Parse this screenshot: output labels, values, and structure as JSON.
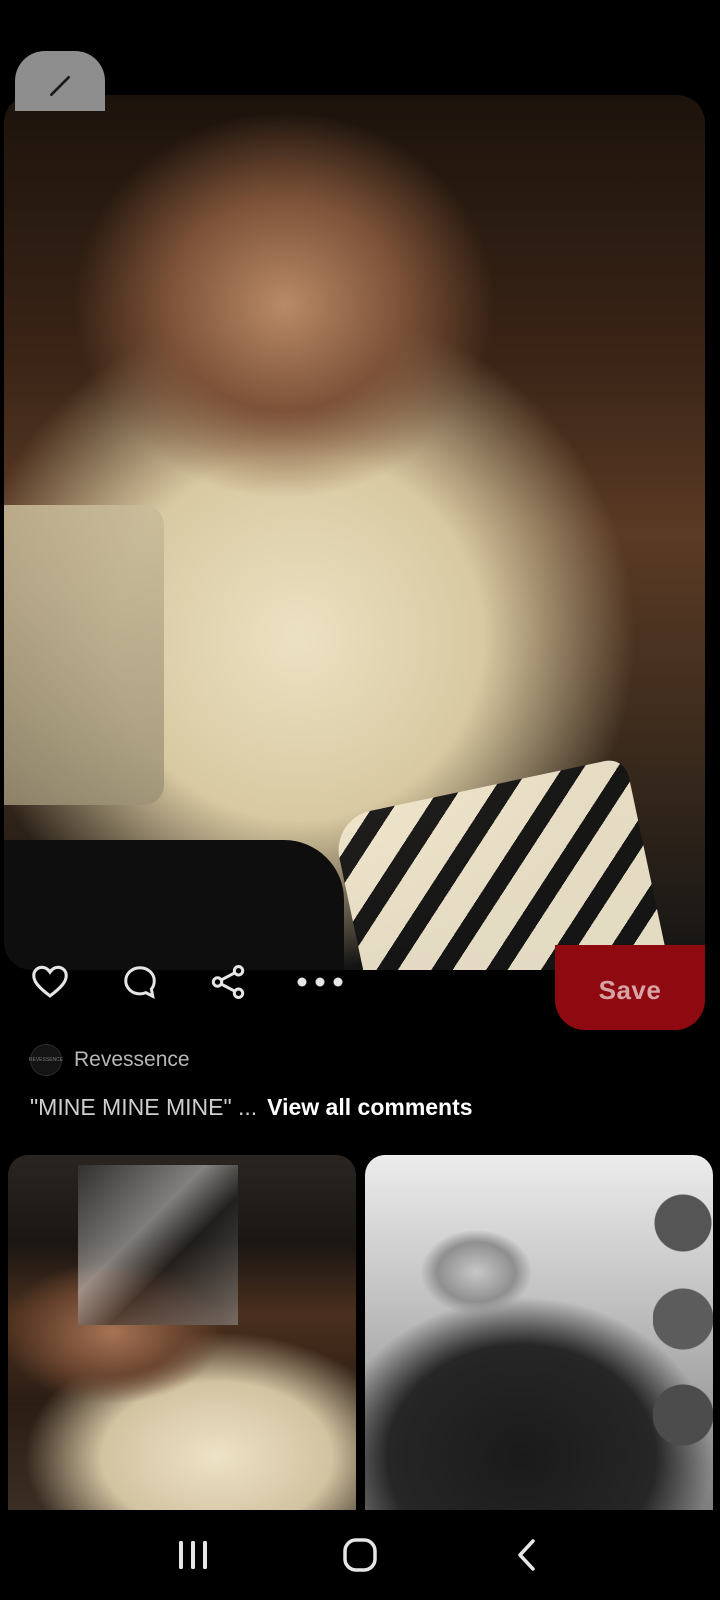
{
  "pin": {
    "image_alt": "Young man in cream open shirt smiling, seated on sofa beside patterned pillow"
  },
  "actions": {
    "save_label": "Save",
    "like_icon": "heart-icon",
    "comment_icon": "comment-icon",
    "share_icon": "share-icon",
    "more_icon": "more-icon"
  },
  "author": {
    "name": "Revessence",
    "avatar_text": "REVESSENCE"
  },
  "comments": {
    "preview": "\"MINE MINE MINE\" ...",
    "view_all_label": "View all comments"
  },
  "colors": {
    "save_bg": "#8f0a10",
    "save_text": "#d8a3a5",
    "background": "#000000"
  },
  "navbar": {
    "recents_icon": "recents-icon",
    "home_icon": "home-icon",
    "back_icon": "back-icon"
  }
}
